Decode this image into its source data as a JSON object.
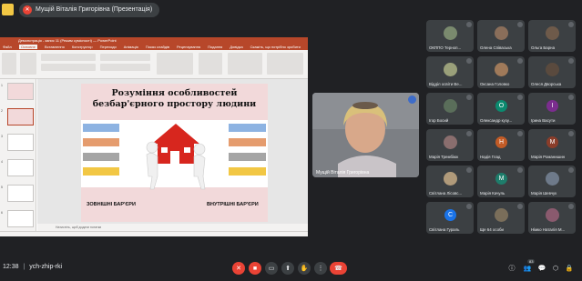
{
  "presenter_bar": {
    "label": "Мущій Віталія Григорівна (Презентація)"
  },
  "powerpoint": {
    "title_text": "Демонстрація - запис 11 (Режим сумісності) — PowerPoint",
    "tabs": [
      "Файл",
      "Основне",
      "Вставлення",
      "Конструктор",
      "Переходи",
      "Анімація",
      "Показ слайдів",
      "Рецензування",
      "Подання",
      "Довідка",
      "Скажіть, що потрібно зробити"
    ],
    "slide_numbers": [
      "1",
      "2",
      "3",
      "4",
      "5",
      "6"
    ],
    "notes_placeholder": "Натисніть, щоб додати нотатки",
    "slide": {
      "title": "Розуміння особливостей безбар'єрного простору людини",
      "left_caption": "ЗОВНІШНІ БАР'ЄРИ",
      "right_caption": "ВНУТРІШНІ БАР'ЄРИ"
    }
  },
  "presenter_video": {
    "name": "Мущій Віталія Григорівна"
  },
  "participants": [
    {
      "name": "ОКППО Терноп...",
      "kind": "photo",
      "color": "#7a8a6e"
    },
    {
      "name": "Олена Співаська",
      "kind": "photo",
      "color": "#8a6e5a"
    },
    {
      "name": "Ольга Барна",
      "kind": "photo",
      "color": "#6e5a4a"
    },
    {
      "name": "Відділ освіти Ве...",
      "kind": "photo",
      "color": "#9aa07a"
    },
    {
      "name": "Оксана Головко",
      "kind": "photo",
      "color": "#a07a5a"
    },
    {
      "name": "Олеся Дворська",
      "kind": "photo",
      "color": "#5a4a3e"
    },
    {
      "name": "Ігор Босий",
      "kind": "photo",
      "color": "#5a6e5a"
    },
    {
      "name": "Олександр кузу...",
      "kind": "letter",
      "letter": "О",
      "color": "#0b8a6f"
    },
    {
      "name": "Ірина Васути",
      "kind": "letter",
      "letter": "І",
      "color": "#7b2d8e"
    },
    {
      "name": "Марія Трембіюк",
      "kind": "photo",
      "color": "#8a6e6e"
    },
    {
      "name": "Надія Глад",
      "kind": "letter",
      "letter": "Н",
      "color": "#c25b26"
    },
    {
      "name": "Марія Романишин",
      "kind": "letter",
      "letter": "М",
      "color": "#8a3d2a"
    },
    {
      "name": "Світлана Лісовс...",
      "kind": "photo",
      "color": "#b09a7a"
    },
    {
      "name": "Марія Качуль",
      "kind": "letter",
      "letter": "М",
      "color": "#1e7d6b"
    },
    {
      "name": "Марія Шевчук",
      "kind": "photo",
      "color": "#6e7a8a"
    },
    {
      "name": "Світлана Гураль",
      "kind": "letter",
      "letter": "С",
      "color": "#1a73e8"
    },
    {
      "name": "Ще 64 особи",
      "kind": "group",
      "color": "#7a6e5a"
    },
    {
      "name": "Німко Наталія М...",
      "kind": "photo",
      "color": "#8a5a6e"
    }
  ],
  "bottom_bar": {
    "time": "12:38",
    "separator": "|",
    "meeting_code": "ych-zhip-rki",
    "people_count": "83"
  }
}
